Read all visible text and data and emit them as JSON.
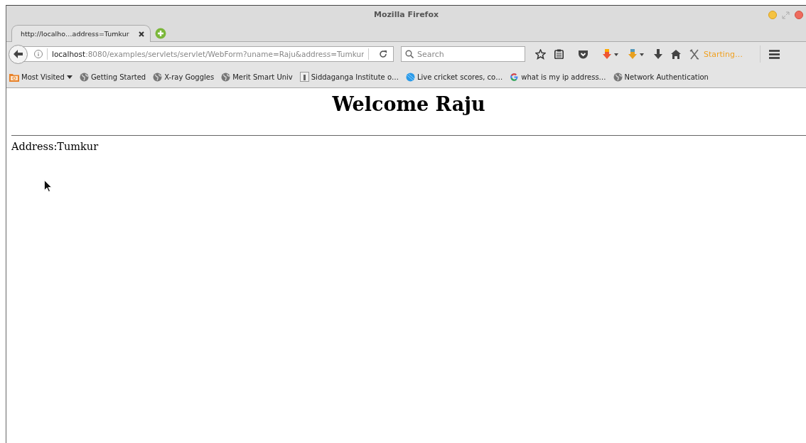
{
  "window": {
    "title": "Mozilla Firefox"
  },
  "tabs": [
    {
      "label": "http://localho…address=Tumkur",
      "selected": true
    }
  ],
  "url": {
    "host": "localhost",
    "rest": ":8080/examples/servlets/servlet/WebForm?uname=Raju&address=Tumkur"
  },
  "search": {
    "placeholder": "Search"
  },
  "toolbar": {
    "status": "Starting…"
  },
  "bookmarks": [
    {
      "label": "Most Visited",
      "kind": "folder"
    },
    {
      "label": "Getting Started",
      "kind": "globe"
    },
    {
      "label": "X-ray Goggles",
      "kind": "globe"
    },
    {
      "label": "Merit Smart Univ",
      "kind": "globe"
    },
    {
      "label": "Siddaganga Institute o…",
      "kind": "page"
    },
    {
      "label": "Live cricket scores, co…",
      "kind": "ball"
    },
    {
      "label": "what is my ip address…",
      "kind": "google"
    },
    {
      "label": "Network Authentication",
      "kind": "globe"
    }
  ],
  "page": {
    "heading": "Welcome Raju",
    "address": "Address:Tumkur"
  }
}
